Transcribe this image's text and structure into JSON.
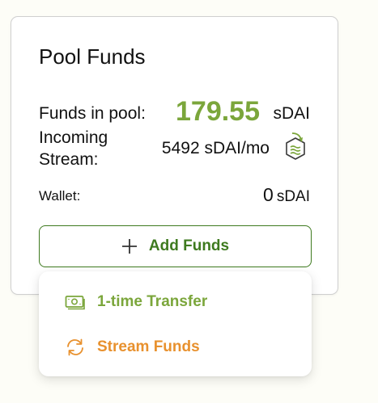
{
  "card": {
    "title": "Pool Funds",
    "funds_in_pool": {
      "label": "Funds in pool:",
      "value": "179.55",
      "unit": "sDAI"
    },
    "incoming_stream": {
      "label": "Incoming Stream:",
      "value": "5492 sDAI/mo",
      "icon": "stream-hexagon-icon"
    },
    "wallet": {
      "label": "Wallet:",
      "value": "0",
      "unit": "sDAI"
    },
    "add_funds_button": {
      "label": "Add Funds",
      "icon": "plus-icon"
    }
  },
  "dropdown_menu": {
    "items": [
      {
        "label": "1-time Transfer",
        "icon": "money-bill-icon",
        "color": "#7ba63b"
      },
      {
        "label": "Stream Funds",
        "icon": "refresh-arrows-icon",
        "color": "#e8912e"
      }
    ]
  },
  "colors": {
    "accent_green": "#7ba63b",
    "button_green": "#3e7a1f",
    "stream_orange": "#e8912e",
    "background": "#fdfdf7"
  }
}
